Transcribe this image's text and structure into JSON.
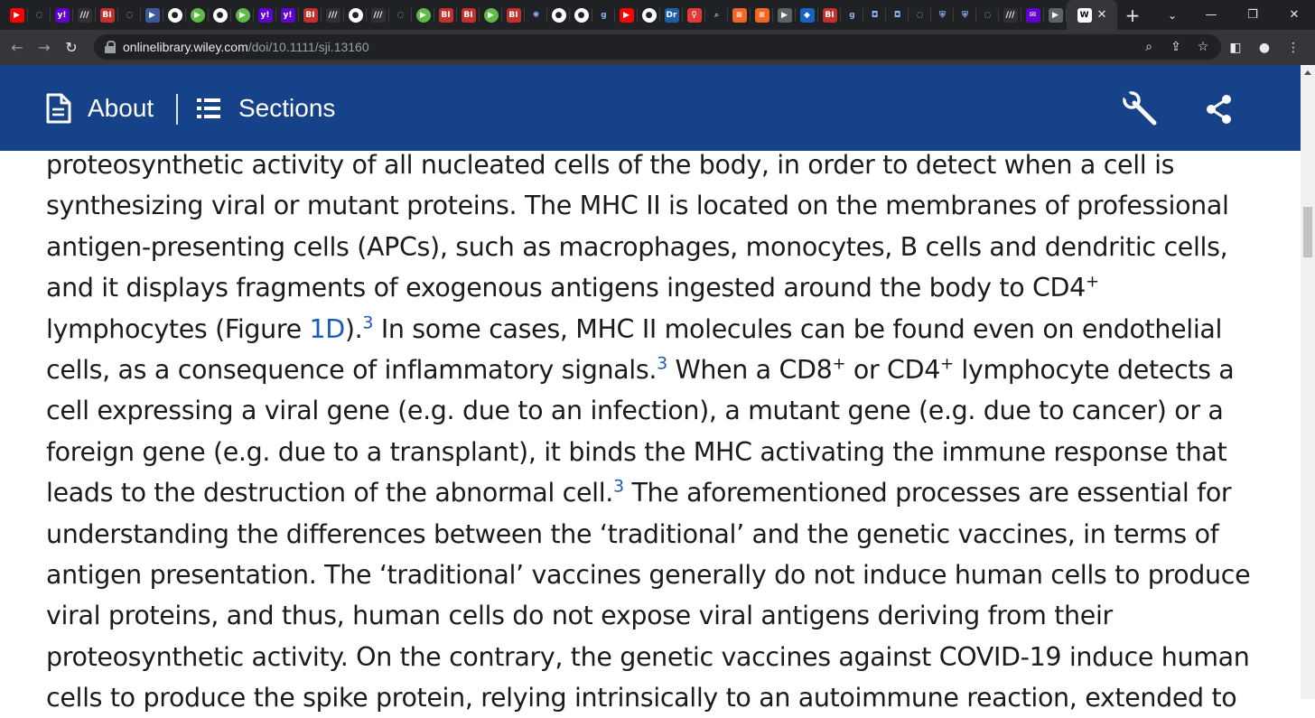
{
  "browser": {
    "tab_favicons": [
      {
        "name": "youtube-icon",
        "bg": "#ff0000",
        "text": "▶"
      },
      {
        "name": "shield-icon",
        "bg": "#202124",
        "text": "◌"
      },
      {
        "name": "yahoo-icon",
        "bg": "#6001d2",
        "text": "y!"
      },
      {
        "name": "document-icon",
        "bg": "#303134",
        "text": "///"
      },
      {
        "name": "bi-icon",
        "bg": "#c4302b",
        "text": "BI"
      },
      {
        "name": "shield-icon",
        "bg": "#202124",
        "text": "◌"
      },
      {
        "name": "flag-icon",
        "bg": "#3c5a99",
        "text": "▶"
      },
      {
        "name": "circle-icon",
        "bg": "#ffffff",
        "text": "●"
      },
      {
        "name": "play-icon",
        "bg": "#5dbb46",
        "text": "▶"
      },
      {
        "name": "circle-icon",
        "bg": "#ffffff",
        "text": "●"
      },
      {
        "name": "play-icon",
        "bg": "#5dbb46",
        "text": "▶"
      },
      {
        "name": "yahoo-icon",
        "bg": "#6001d2",
        "text": "y!"
      },
      {
        "name": "yahoo-icon",
        "bg": "#6001d2",
        "text": "y!"
      },
      {
        "name": "bi-icon",
        "bg": "#c4302b",
        "text": "BI"
      },
      {
        "name": "document-icon",
        "bg": "#303134",
        "text": "///"
      },
      {
        "name": "circle-icon",
        "bg": "#ffffff",
        "text": "●"
      },
      {
        "name": "document-icon",
        "bg": "#303134",
        "text": "///"
      },
      {
        "name": "shield-icon",
        "bg": "#202124",
        "text": "◌"
      },
      {
        "name": "play-icon",
        "bg": "#5dbb46",
        "text": "▶"
      },
      {
        "name": "bi-icon",
        "bg": "#c4302b",
        "text": "BI"
      },
      {
        "name": "bi-icon",
        "bg": "#c4302b",
        "text": "BI"
      },
      {
        "name": "play-icon",
        "bg": "#5dbb46",
        "text": "▶"
      },
      {
        "name": "bi-icon",
        "bg": "#c4302b",
        "text": "BI"
      },
      {
        "name": "starburst-icon",
        "bg": "#202124",
        "text": "✺"
      },
      {
        "name": "circle-icon",
        "bg": "#ffffff",
        "text": "●"
      },
      {
        "name": "circle-icon",
        "bg": "#ffffff",
        "text": "●"
      },
      {
        "name": "g-icon",
        "bg": "#202124",
        "text": "g"
      },
      {
        "name": "youtube-icon",
        "bg": "#ff0000",
        "text": "▶"
      },
      {
        "name": "circle-icon",
        "bg": "#ffffff",
        "text": "●"
      },
      {
        "name": "dr-icon",
        "bg": "#1b5fa8",
        "text": "Dr"
      },
      {
        "name": "location-icon",
        "bg": "#e53935",
        "text": "♀"
      },
      {
        "name": "search-icon",
        "bg": "#202124",
        "text": "⌕"
      },
      {
        "name": "bookmark-icon",
        "bg": "#f26522",
        "text": "≡"
      },
      {
        "name": "bookmark-icon",
        "bg": "#f26522",
        "text": "≡"
      },
      {
        "name": "flag-icon",
        "bg": "#5f6368",
        "text": "▶"
      },
      {
        "name": "cube-icon",
        "bg": "#1565c0",
        "text": "◆"
      },
      {
        "name": "bi-icon",
        "bg": "#c4302b",
        "text": "BI"
      },
      {
        "name": "g-icon",
        "bg": "#202124",
        "text": "g"
      },
      {
        "name": "shield-orange-icon",
        "bg": "#202124",
        "text": "◘"
      },
      {
        "name": "shield-orange-icon",
        "bg": "#202124",
        "text": "◘"
      },
      {
        "name": "shield-icon",
        "bg": "#202124",
        "text": "◌"
      },
      {
        "name": "crest-icon",
        "bg": "#202124",
        "text": "⛨"
      },
      {
        "name": "crest-icon",
        "bg": "#202124",
        "text": "⛨"
      },
      {
        "name": "shield-icon",
        "bg": "#202124",
        "text": "◌"
      },
      {
        "name": "document-icon",
        "bg": "#303134",
        "text": "///"
      },
      {
        "name": "mail-icon",
        "bg": "#6001d2",
        "text": "✉"
      },
      {
        "name": "flag-icon",
        "bg": "#5f6368",
        "text": "▶"
      }
    ],
    "active_tab_favicon": "W",
    "active_tab_close": "✕",
    "new_tab": "+",
    "window_controls": [
      "⌄",
      "—",
      "❐",
      "✕"
    ],
    "url_domain": "onlinelibrary.wiley.com",
    "url_path": "/doi/10.1111/sji.13160",
    "omnibox_icons": [
      "zoom-icon",
      "share-icon",
      "star-icon"
    ],
    "toolbar_right_icons": [
      "sidepanel-icon",
      "profile-icon",
      "menu-icon"
    ]
  },
  "pagebar": {
    "about_label": "About",
    "sections_label": "Sections",
    "bg_color": "#154288"
  },
  "article": {
    "l1": "proteosynthetic activity of all nucleated cells of the body, in order to detect when a cell is",
    "l2": "synthesizing viral or mutant proteins. The MHC II is located on the membranes of professional",
    "l3": "antigen-presenting cells (APCs), such as macrophages, monocytes, B cells and dendritic cells,",
    "l4a": "and it displays fragments of exogenous antigens ingested around the body to CD4",
    "l4sup": "+",
    "l5a": "lymphocytes (Figure ",
    "l5link": "1D",
    "l5b": ").",
    "l5ref": "3",
    "l5c": " In some cases, MHC II molecules can be found even on endothelial",
    "l6a": "cells, as a consequence of inflammatory signals.",
    "l6ref": "3",
    "l6b": " When a CD8",
    "l6sup1": "+",
    "l6c": " or CD4",
    "l6sup2": "+",
    "l6d": " lymphocyte detects a",
    "l7": "cell expressing a viral gene (e.g. due to an infection), a mutant gene (e.g. due to cancer) or a",
    "l8": "foreign gene (e.g. due to a transplant), it binds the MHC activating the immune response that",
    "l9a": "leads to the destruction of the abnormal cell.",
    "l9ref": "3",
    "l9b": " The aforementioned processes are essential for",
    "l10": "understanding the differences between the ‘traditional’ and the genetic vaccines, in terms of",
    "l11": "antigen presentation. The ‘traditional’ vaccines generally do not induce human cells to produce",
    "l12": "viral proteins, and thus, human cells do not expose viral antigens deriving from their",
    "l13": "proteosynthetic activity. On the contrary, the genetic vaccines against COVID-19 induce human",
    "l14": "cells to produce the spike protein, relying intrinsically to an autoimmune reaction, extended to"
  }
}
